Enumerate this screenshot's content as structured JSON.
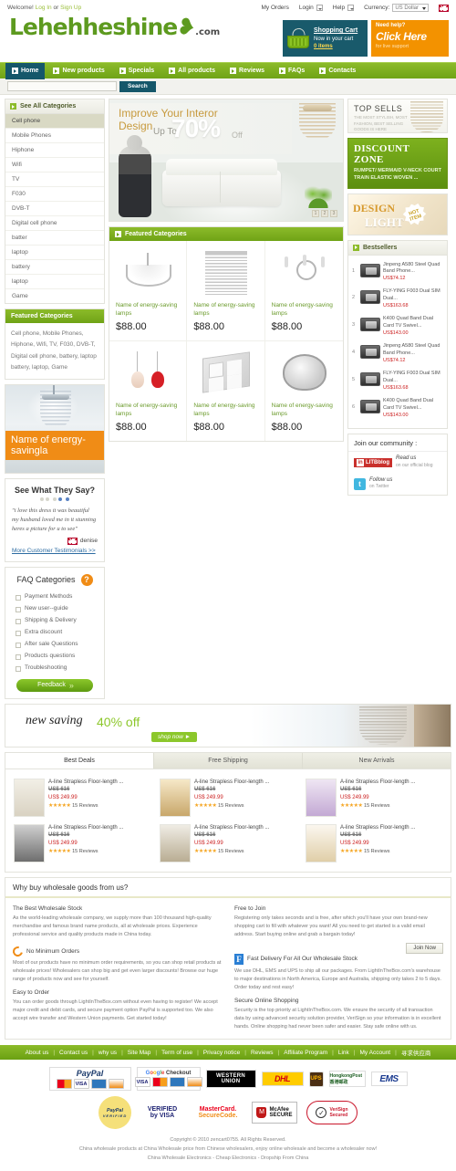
{
  "topbar": {
    "welcome": "Welcome!",
    "login": "Log In",
    "or": "or",
    "signup": "Sign Up",
    "my_orders": "My Orders",
    "login_menu": "Login",
    "help_menu": "Help",
    "currency_label": "Currency:",
    "currency_value": "US Dollar"
  },
  "header": {
    "logo_text": "Lehehheshine",
    "logo_suffix": ".com",
    "cart": {
      "title": "Shopping Cart",
      "line2": "Now in your cart",
      "items": "0 items"
    },
    "help": {
      "line1": "Need help?",
      "line2": "Click Here",
      "line3": "for live support"
    }
  },
  "nav": {
    "items": [
      {
        "label": "Home",
        "active": true
      },
      {
        "label": "New products",
        "active": false
      },
      {
        "label": "Specials",
        "active": false
      },
      {
        "label": "All products",
        "active": false
      },
      {
        "label": "Reviews",
        "active": false
      },
      {
        "label": "FAQs",
        "active": false
      },
      {
        "label": "Contacts",
        "active": false
      }
    ]
  },
  "search": {
    "value": "",
    "placeholder": "",
    "button": "Search"
  },
  "sidebar": {
    "categories_title": "See All Categories",
    "categories": [
      "Cell phone",
      "Mobile Phones",
      "Hiphone",
      "Wifi",
      "TV",
      "F030",
      "DVB-T",
      "Digital cell phone",
      "batter",
      "laptop",
      "battery",
      "laptop",
      "Game"
    ],
    "selected_category": "Cell phone",
    "featured_title": "Featured Categories",
    "featured_text": "Cell phone, Mobile Phones, Hiphone, Wifi, TV, F030, DVB-T, Digital cell phone, battery, laptop battery, laptop, Game",
    "promo_label": "Name of energy-savingla",
    "testimonials": {
      "title": "See What They Say?",
      "quote": "\"i love this dress it was beautiful my husband loved me in it stunning heres a picture for u to see\"",
      "author": "denise",
      "more_link": "More Customer Testimonials >>"
    },
    "faq": {
      "title": "FAQ Categories",
      "items": [
        "Payment Methods",
        "New user--guide",
        "Shipping & Delivery",
        "Extra discount",
        "After sale Questions",
        "Products questions",
        "Troubleshooting"
      ],
      "feedback_button": "Feedback"
    }
  },
  "banner": {
    "line1": "Improve Your Interor Design",
    "up_to": "Up To",
    "percent": "70%",
    "off": "Off",
    "slides": [
      "1",
      "2",
      "3"
    ]
  },
  "featured": {
    "title": "Featured Categories",
    "products": [
      {
        "name": "Name of energy-saving lamps",
        "price": "$88.00",
        "thumb": "chandelier-classic"
      },
      {
        "name": "Name of energy-saving lamps",
        "price": "$88.00",
        "thumb": "crystal-curtain-lamp"
      },
      {
        "name": "Name of energy-saving lamps",
        "price": "$88.00",
        "thumb": "candle-wall-lamp"
      },
      {
        "name": "Name of energy-saving lamps",
        "price": "$88.00",
        "thumb": "pendant-drop-lamps"
      },
      {
        "name": "Name of energy-saving lamps",
        "price": "$88.00",
        "thumb": "square-ceiling-lamp"
      },
      {
        "name": "Name of energy-saving lamps",
        "price": "$88.00",
        "thumb": "crystal-dome-lamp"
      }
    ]
  },
  "right": {
    "topsells": {
      "title": "TOP SELLS",
      "subtitle": "THE MOST STYLISH, MOST FASHION, BEST SELLING GOODS IS HERE"
    },
    "discount_zone": {
      "title": "DISCOUNT ZONE",
      "subtitle": "RUMPET/ MERMAID V-NECK COURT TRAIN ELASTIC WOVEN ..."
    },
    "design_light": {
      "word1": "DESIGN",
      "word2": "LIGHT",
      "badge": "HOT ITEM"
    },
    "bestsellers_title": "Bestsellers",
    "bestsellers": [
      {
        "rank": "1",
        "name": "Jinpeng A580 Steel Quad Band Phone...",
        "price": "US$74.12"
      },
      {
        "rank": "2",
        "name": "FLY-YING F003 Dual SIM Dual...",
        "price": "US$163.68"
      },
      {
        "rank": "3",
        "name": "K400 Quad Band Dual Card TV Swivel...",
        "price": "US$143.00"
      },
      {
        "rank": "4",
        "name": "Jinpeng A580 Steel Quad Band Phone...",
        "price": "US$74.12"
      },
      {
        "rank": "5",
        "name": "FLY-YING F003 Dual SIM Dual...",
        "price": "US$163.68"
      },
      {
        "rank": "6",
        "name": "K400 Quad Band Dual Card TV Swivel...",
        "price": "US$143.00"
      }
    ],
    "community": {
      "title": "Join our community :",
      "blog_badge": "LITBblog",
      "blog_text": "Read us",
      "blog_sub": "on our official blog",
      "twitter_text": "Follow us",
      "twitter_sub": "on Twitter"
    }
  },
  "saving_banner": {
    "text1": "new saving",
    "text2": "40% off",
    "button": "shop now ►"
  },
  "deals": {
    "tabs": [
      {
        "label": "Best Deals",
        "active": true
      },
      {
        "label": "Free Shipping",
        "active": false
      },
      {
        "label": "New Arrivals",
        "active": false
      }
    ],
    "items": [
      {
        "name": "A-line Strapless Floor-length ...",
        "old_price": "US$ 616",
        "new_price": "US$ 249.99",
        "reviews": "15 Reviews",
        "stars": "★★★★★"
      },
      {
        "name": "A-line Strapless Floor-length ...",
        "old_price": "US$ 616",
        "new_price": "US$ 249.99",
        "reviews": "15 Reviews",
        "stars": "★★★★★"
      },
      {
        "name": "A-line Strapless Floor-length ...",
        "old_price": "US$ 616",
        "new_price": "US$ 249.99",
        "reviews": "15 Reviews",
        "stars": "★★★★★"
      },
      {
        "name": "A-line Strapless Floor-length ...",
        "old_price": "US$ 616",
        "new_price": "US$ 249.99",
        "reviews": "15 Reviews",
        "stars": "★★★★★"
      },
      {
        "name": "A-line Strapless Floor-length ...",
        "old_price": "US$ 616",
        "new_price": "US$ 249.99",
        "reviews": "15 Reviews",
        "stars": "★★★★★"
      },
      {
        "name": "A-line Strapless Floor-length ...",
        "old_price": "US$ 616",
        "new_price": "US$ 249.99",
        "reviews": "15 Reviews",
        "stars": "★★★★★"
      }
    ]
  },
  "why": {
    "heading": "Why buy wholesale goods from us?",
    "join_now": "Join Now",
    "left": [
      {
        "title": "The Best Wholesale Stock",
        "text": "As the world-leading wholesale company, we supply more than 100 thousand high-quality merchandise and famous brand name products, all at wholesale prices. Experience professional service and quality products made in China today."
      },
      {
        "title": "No Minimum Orders",
        "text": "Most of our products have no minimum order requirements, so you can shop retail products at wholesale prices! Wholesalers can shop big and get even larger discounts! Browse our huge range of products now and see for yourself."
      },
      {
        "title": "Easy to Order",
        "text": "You can order goods through LightInTheBox.com without even having to register! We accept major credit and debit cards, and secure payment option PayPal is supported too. We also accept wire transfer and Western Union payments. Get started today!"
      }
    ],
    "right": [
      {
        "title": "Free to Join",
        "text": "Registering only takes seconds and is free, after which you'll have your own brand-new shopping cart to fill with whatever you want! All you need to get started is a valid email address. Start buying online and grab a bargain today!"
      },
      {
        "title": "Fast Delivery For All Our Wholesale Stock",
        "text": "We use DHL, EMS and UPS to ship all our packages. From LightInTheBox.com's warehouse to major destinations in North America, Europe and Australia, shipping only takes 2 to 5 days. Order today and rest easy!"
      },
      {
        "title": "Secure Online Shopping",
        "text": "Security is the top priority at LightInTheBox.com. We ensure the security of all transaction data by using advanced security solution provider, VeriSign so your information is in excellent hands. Online shopping had never been safer and easier. Stay safe online with us."
      }
    ]
  },
  "footer": {
    "links": [
      "About us",
      "Contact us",
      "why us",
      "Site Map",
      "Term of use",
      "Privacy notice",
      "Reviews",
      "Affiliate Program",
      "Link",
      "My Account",
      "寻求供应商"
    ],
    "payments": {
      "paypal": "PayPal",
      "visa": "VISA",
      "google": "Checkout",
      "google_word": "Google",
      "western_union_1": "WESTERN",
      "western_union_2": "UNION",
      "dhl": "DHL",
      "ups": "UPS",
      "hk_post": "HongkongPost 香港邮政",
      "ems": "EMS"
    },
    "seals": {
      "paypal_verified_1": "PayPal",
      "paypal_verified_2": "VERIFIED",
      "visa_1": "VERIFIED",
      "visa_2": "by VISA",
      "mc_1": "MasterCard.",
      "mc_2": "SecureCode.",
      "mcafee_1": "McAfee",
      "mcafee_2": "SECURE",
      "verisign_1": "VeriSign",
      "verisign_2": "Secured"
    },
    "copyright": "Copyright © 2010 zencart0755. All Rights Reserved.",
    "tagline_2": "China wholesale products at China Wholesale price from Chinese wholesalers, enjoy online wholesale and become a wholesaler now!",
    "tagline_3": "China Wholesale Electronics - Cheap Electronics - Dropship From China"
  }
}
